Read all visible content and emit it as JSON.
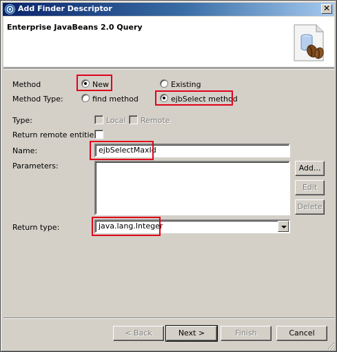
{
  "window": {
    "title": "Add Finder Descriptor",
    "close_glyph": "✕"
  },
  "banner": {
    "title": "Enterprise JavaBeans 2.0 Query",
    "image_icon": "ejb-bean-icon"
  },
  "form": {
    "method_label": "Method",
    "method_new": "New",
    "method_existing": "Existing",
    "method_selected": "New",
    "method_type_label": "Method Type:",
    "method_type_find": "find method",
    "method_type_ejbselect": "ejbSelect method",
    "method_type_selected": "ejbSelect method",
    "type_label": "Type:",
    "type_local": "Local",
    "type_remote": "Remote",
    "return_remote_label": "Return remote entities:",
    "name_label": "Name:",
    "name_value": "ejbSelectMaxId",
    "parameters_label": "Parameters:",
    "parameters": [],
    "add_button": "Add...",
    "edit_button": "Edit",
    "delete_button": "Delete",
    "return_type_label": "Return type:",
    "return_type_value": "java.lang.Integer"
  },
  "footer": {
    "back": "< Back",
    "next": "Next >",
    "finish": "Finish",
    "cancel": "Cancel"
  },
  "colors": {
    "highlight": "#e0001a",
    "titlebar_start": "#0a246a",
    "titlebar_end": "#a6caf0",
    "dialog_bg": "#d4d0c8"
  }
}
